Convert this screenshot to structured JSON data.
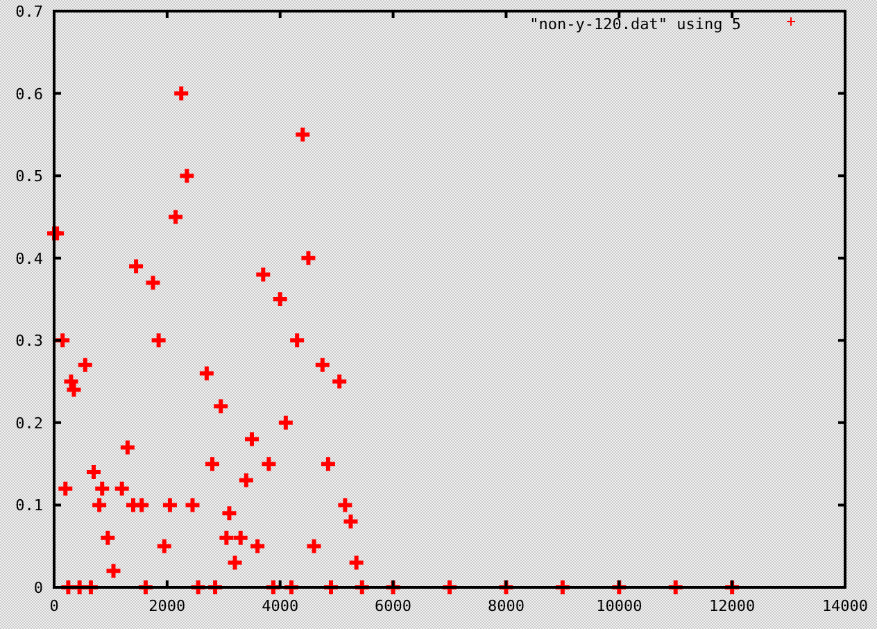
{
  "chart_data": {
    "type": "scatter",
    "x": [
      0,
      50,
      150,
      200,
      250,
      300,
      350,
      450,
      550,
      650,
      700,
      800,
      850,
      950,
      1050,
      1200,
      1300,
      1400,
      1450,
      1550,
      1620,
      1750,
      1850,
      1950,
      2050,
      2150,
      2250,
      2350,
      2450,
      2550,
      2700,
      2800,
      2850,
      2950,
      3050,
      3100,
      3200,
      3300,
      3400,
      3500,
      3600,
      3700,
      3800,
      3880,
      4000,
      4100,
      4200,
      4300,
      4400,
      4500,
      4600,
      4750,
      4850,
      4900,
      5050,
      5150,
      5250,
      5350,
      5450,
      6000,
      7000,
      8000,
      9000,
      10000,
      11000,
      12000
    ],
    "series": [
      {
        "name": "\"non-y-120.dat\" using 5",
        "color": "#ff0000",
        "values": [
          0.43,
          0.43,
          0.3,
          0.12,
          0.0,
          0.25,
          0.24,
          0.0,
          0.27,
          0.0,
          0.14,
          0.1,
          0.12,
          0.06,
          0.02,
          0.12,
          0.17,
          0.1,
          0.39,
          0.1,
          0.0,
          0.37,
          0.3,
          0.05,
          0.1,
          0.45,
          0.6,
          0.5,
          0.1,
          0.0,
          0.26,
          0.15,
          0.0,
          0.22,
          0.06,
          0.09,
          0.03,
          0.06,
          0.13,
          0.18,
          0.05,
          0.38,
          0.15,
          0.0,
          0.35,
          0.2,
          0.0,
          0.3,
          0.55,
          0.4,
          0.05,
          0.27,
          0.15,
          0.0,
          0.25,
          0.1,
          0.08,
          0.03,
          0.0,
          0,
          0,
          0,
          0,
          0,
          0,
          0
        ]
      }
    ],
    "xlim": [
      0,
      14000
    ],
    "ylim": [
      0,
      0.7
    ],
    "xticks": [
      0,
      2000,
      4000,
      6000,
      8000,
      10000,
      12000,
      14000
    ],
    "yticks": [
      0,
      0.1,
      0.2,
      0.3,
      0.4,
      0.5,
      0.6,
      0.7
    ]
  }
}
